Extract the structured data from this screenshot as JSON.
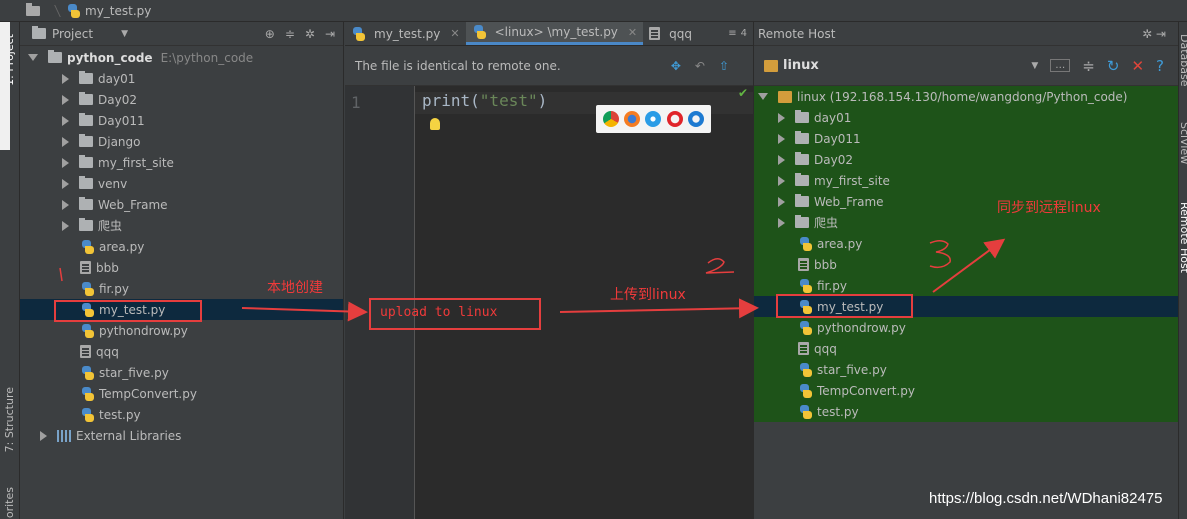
{
  "breadcrumb": {
    "file": "my_test.py"
  },
  "left_stripe": {
    "tabs": [
      "1: Project",
      "7: Structure",
      "orites"
    ]
  },
  "project": {
    "header_label": "Project",
    "root_name": "python_code",
    "root_path": "E:\\python_code",
    "folders": [
      "day01",
      "Day02",
      "Day011",
      "Django",
      "my_first_site",
      "venv",
      "Web_Frame",
      "爬虫"
    ],
    "files": [
      {
        "name": "area.py",
        "type": "py"
      },
      {
        "name": "bbb",
        "type": "txt"
      },
      {
        "name": "fir.py",
        "type": "py"
      },
      {
        "name": "my_test.py",
        "type": "py"
      },
      {
        "name": "pythondrow.py",
        "type": "py"
      },
      {
        "name": "qqq",
        "type": "txt"
      },
      {
        "name": "star_five.py",
        "type": "py"
      },
      {
        "name": "TempConvert.py",
        "type": "py"
      },
      {
        "name": "test.py",
        "type": "py"
      }
    ],
    "external_libraries": "External Libraries"
  },
  "editor": {
    "tabs": [
      {
        "label": "my_test.py"
      },
      {
        "label": "<linux> \\my_test.py"
      },
      {
        "label": "qqq"
      }
    ],
    "tab_overflow": "4",
    "notice": "The file is identical to remote one.",
    "line_number": "1",
    "code_func": "print(",
    "code_str": "\"test\"",
    "code_close": ")"
  },
  "remote": {
    "panel_title": "Remote Host",
    "server_name": "linux",
    "root_label": "linux (192.168.154.130/home/wangdong/Python_code)",
    "folders": [
      "day01",
      "Day011",
      "Day02",
      "my_first_site",
      "Web_Frame",
      "爬虫"
    ],
    "files": [
      {
        "name": "area.py",
        "type": "py"
      },
      {
        "name": "bbb",
        "type": "txt"
      },
      {
        "name": "fir.py",
        "type": "py"
      },
      {
        "name": "my_test.py",
        "type": "py"
      },
      {
        "name": "pythondrow.py",
        "type": "py"
      },
      {
        "name": "qqq",
        "type": "txt"
      },
      {
        "name": "star_five.py",
        "type": "py"
      },
      {
        "name": "TempConvert.py",
        "type": "py"
      },
      {
        "name": "test.py",
        "type": "py"
      }
    ]
  },
  "right_stripe": {
    "tabs": [
      "Database",
      "SciView",
      "Remote Host"
    ]
  },
  "annotations": {
    "local_create": "本地创建",
    "upload_box": "upload to linux",
    "upload_label": "上传到linux",
    "sync_label": "同步到远程linux"
  },
  "watermark": "https://blog.csdn.net/WDhani82475",
  "colors": {
    "remote_bg": "#1e5319",
    "selection": "#0d293e",
    "annotation": "#e53e3e"
  }
}
